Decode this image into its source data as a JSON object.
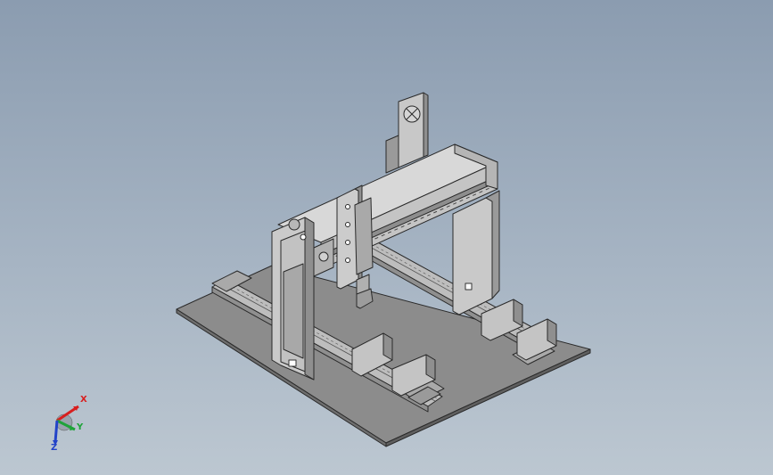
{
  "viewport": {
    "background_top": "#8b9cb0",
    "background_bottom": "#bcc7d1"
  },
  "model": {
    "part_fill": "#c9c9c9",
    "part_dark": "#7d7d7d",
    "edge_color": "#2a2a2a",
    "base_fill": "#8c8c8c"
  },
  "triad": {
    "x_label": "X",
    "y_label": "Y",
    "z_label": "Z",
    "x_color": "#d81f1f",
    "y_color": "#1fa33a",
    "z_color": "#2343c8"
  }
}
